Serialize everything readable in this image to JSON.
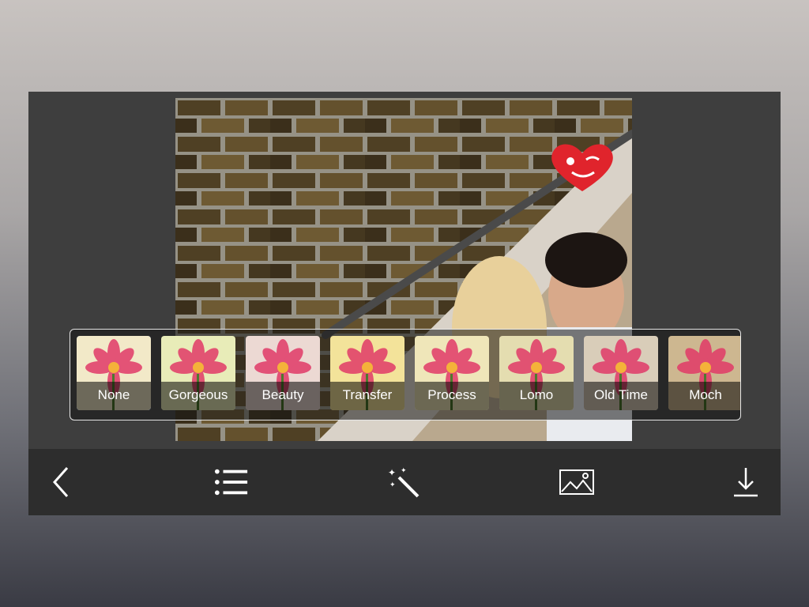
{
  "editor": {
    "filters": [
      {
        "label": "None",
        "selected": true,
        "tint": "#f2e9c8"
      },
      {
        "label": "Gorgeous",
        "selected": false,
        "tint": "#e8ecb8"
      },
      {
        "label": "Beauty",
        "selected": false,
        "tint": "#ecd9d3"
      },
      {
        "label": "Transfer",
        "selected": false,
        "tint": "#f3e39a"
      },
      {
        "label": "Process",
        "selected": false,
        "tint": "#efe6b9"
      },
      {
        "label": "Lomo",
        "selected": false,
        "tint": "#e4ddb0"
      },
      {
        "label": "Old Time",
        "selected": false,
        "tint": "#d9cdb9"
      },
      {
        "label": "Moch",
        "selected": false,
        "tint": "#cdb790"
      }
    ],
    "toolbar": {
      "back_icon": "chevron-left-icon",
      "list_icon": "list-icon",
      "effects_icon": "magic-wand-icon",
      "image_icon": "image-icon",
      "download_icon": "download-icon"
    },
    "colors": {
      "accent": "#2d6bf0",
      "toolbar": "#2d2d2d",
      "panel": "#3e3e3e"
    }
  }
}
